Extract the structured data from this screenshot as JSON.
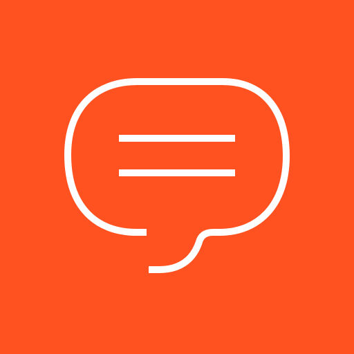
{
  "icon": {
    "name": "chat-bubble-icon",
    "background_color": "#FF5220",
    "foreground_color": "#FFFFFF"
  }
}
